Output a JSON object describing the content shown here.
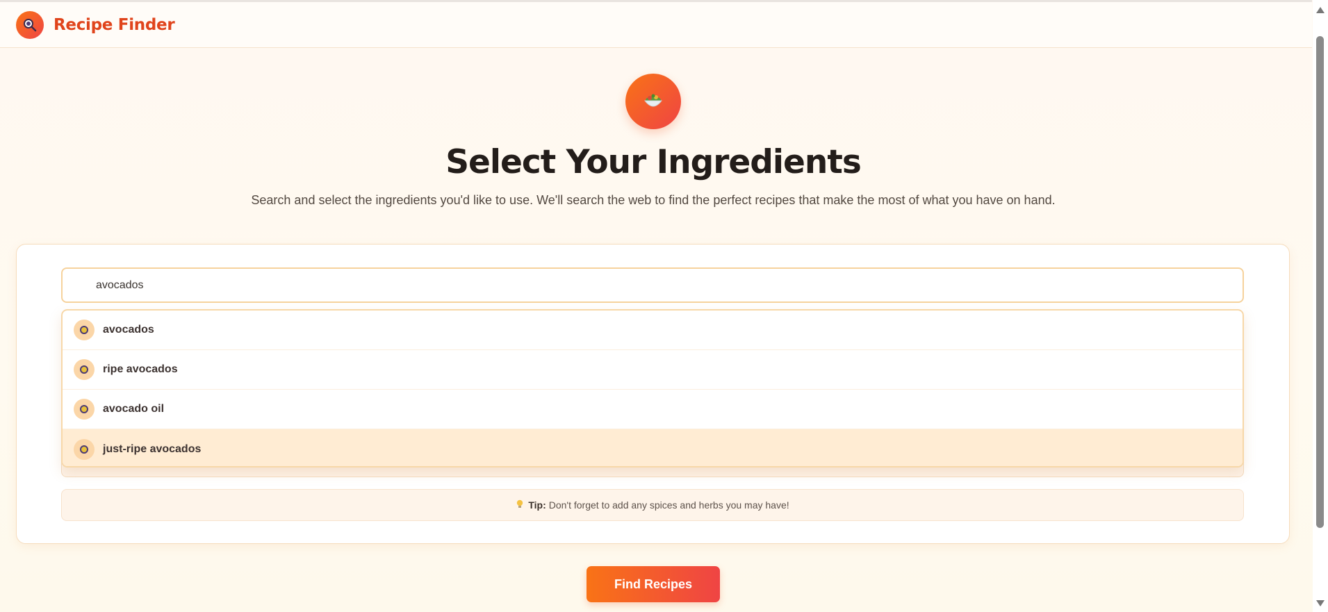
{
  "header": {
    "app_title": "Recipe Finder",
    "logo_icon": "magnifier-icon"
  },
  "hero": {
    "icon": "salad-bowl-icon",
    "title": "Select Your Ingredients",
    "subtitle": "Search and select the ingredients you'd like to use. We'll search the web to find the perfect recipes that make the most of what you have on hand."
  },
  "search": {
    "value": "avocados",
    "icon": "search-icon"
  },
  "suggestions": [
    {
      "label": "avocados",
      "icon": "ingredient-icon",
      "highlighted": false
    },
    {
      "label": "ripe avocados",
      "icon": "ingredient-icon",
      "highlighted": false
    },
    {
      "label": "avocado oil",
      "icon": "ingredient-icon",
      "highlighted": false
    },
    {
      "label": "just-ripe avocados",
      "icon": "ingredient-icon",
      "highlighted": true
    }
  ],
  "tip": {
    "icon": "lightbulb-icon",
    "label": "Tip:",
    "text": "Don't forget to add any spices and herbs you may have!"
  },
  "actions": {
    "find_label": "Find Recipes"
  },
  "colors": {
    "accent_start": "#f97316",
    "accent_end": "#ef4444",
    "brand_text": "#e0441c",
    "highlight": "#ffecd3"
  }
}
